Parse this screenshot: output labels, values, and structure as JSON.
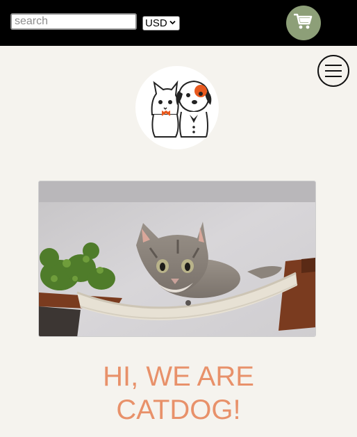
{
  "header": {
    "search": {
      "placeholder": "search",
      "value": ""
    },
    "currency": {
      "selected": "USD"
    },
    "cart_icon": "shopping-cart-icon",
    "colors": {
      "background": "#000000",
      "cart_button": "#8d9f78"
    }
  },
  "nav": {
    "menu_icon": "hamburger-menu-icon"
  },
  "logo": {
    "icon": "cat-and-dog-logo"
  },
  "hero": {
    "image": "cat-in-hammock-photo"
  },
  "headline": {
    "line1": "HI, WE ARE",
    "line2": "CATDOG!",
    "color": "#e8916a"
  }
}
